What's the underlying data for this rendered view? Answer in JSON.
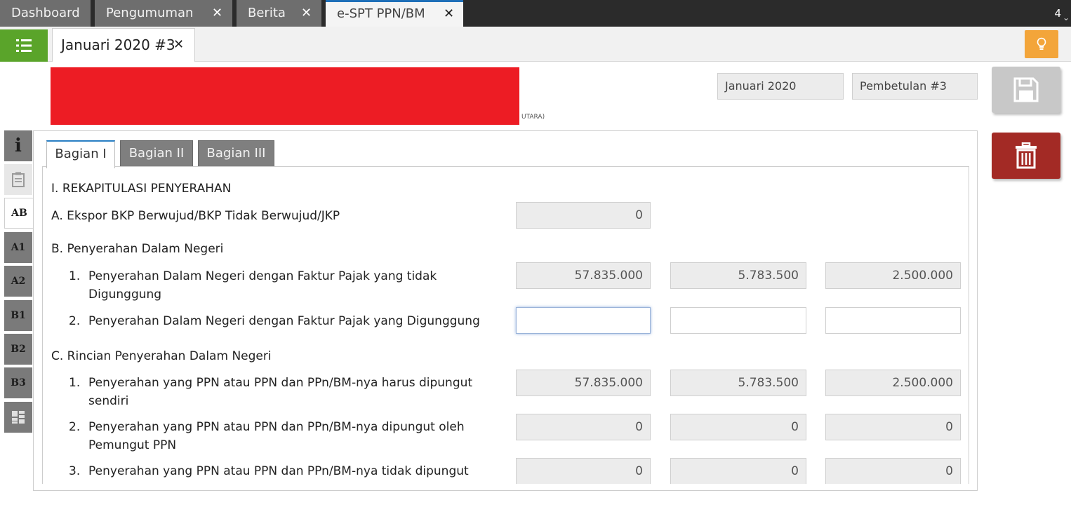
{
  "top_tabs": [
    {
      "label": "Dashboard"
    },
    {
      "label": "Pengumuman"
    },
    {
      "label": "Berita"
    },
    {
      "label": "e-SPT PPN/BM"
    }
  ],
  "top_tab_count": "4",
  "doc_tab": {
    "label": "Januari 2020 #3"
  },
  "header": {
    "redacted_tail": "UTARA)",
    "period": "Januari 2020",
    "revision": "Pembetulan #3"
  },
  "side_nav": [
    "AB",
    "A1",
    "A2",
    "B1",
    "B2",
    "B3"
  ],
  "bagian_tabs": [
    "Bagian I",
    "Bagian II",
    "Bagian III"
  ],
  "form": {
    "section_title": "I. REKAPITULASI PENYERAHAN",
    "a_label": "A. Ekspor BKP Berwujud/BKP Tidak Berwujud/JKP",
    "a_value": "0",
    "b_label": "B. Penyerahan Dalam Negeri",
    "b_rows": [
      {
        "num": "1.",
        "line1": "Penyerahan Dalam Negeri dengan Faktur Pajak yang tidak",
        "line2": "Digunggung",
        "v1": "57.835.000",
        "v2": "5.783.500",
        "v3": "2.500.000"
      },
      {
        "num": "2.",
        "line1": "Penyerahan Dalam Negeri dengan Faktur Pajak yang Digunggung",
        "line2": "",
        "v1": "",
        "v2": "",
        "v3": ""
      }
    ],
    "c_label": "C. Rincian Penyerahan Dalam Negeri",
    "c_rows": [
      {
        "num": "1.",
        "line1": "Penyerahan yang PPN atau PPN dan PPn/BM-nya harus dipungut",
        "line2": "sendiri",
        "v1": "57.835.000",
        "v2": "5.783.500",
        "v3": "2.500.000"
      },
      {
        "num": "2.",
        "line1": "Penyerahan yang PPN atau PPN dan PPn/BM-nya dipungut oleh",
        "line2": "Pemungut PPN",
        "v1": "0",
        "v2": "0",
        "v3": "0"
      },
      {
        "num": "3.",
        "line1": "Penyerahan yang PPN atau PPN dan PPn/BM-nya tidak dipungut",
        "line2": "",
        "v1": "0",
        "v2": "0",
        "v3": "0"
      }
    ]
  },
  "colors": {
    "menu_green": "#5aa42a",
    "bulb_orange": "#f3a53a",
    "delete_red": "#a32a25",
    "redaction": "#ed1c24",
    "active_tab_accent": "#1e6fb8"
  }
}
